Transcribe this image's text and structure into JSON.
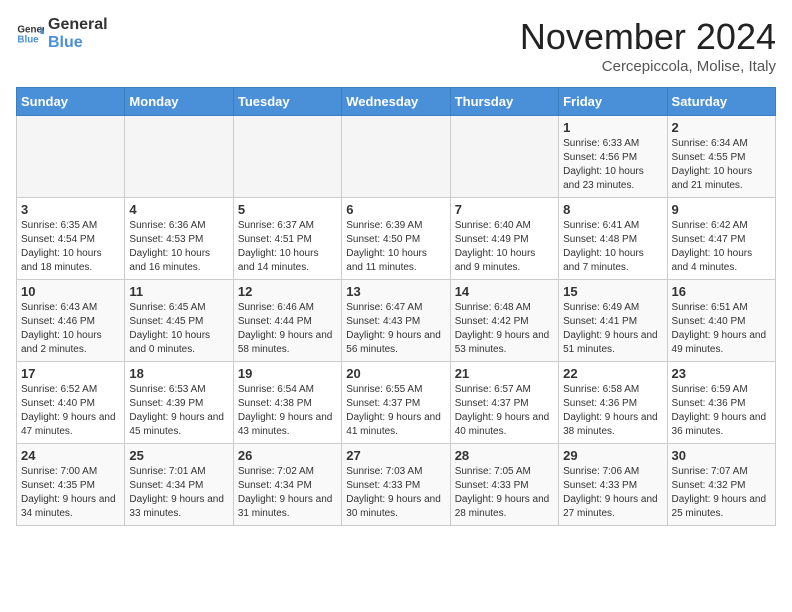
{
  "header": {
    "logo_general": "General",
    "logo_blue": "Blue",
    "title": "November 2024",
    "location": "Cercepiccola, Molise, Italy"
  },
  "weekdays": [
    "Sunday",
    "Monday",
    "Tuesday",
    "Wednesday",
    "Thursday",
    "Friday",
    "Saturday"
  ],
  "weeks": [
    [
      {
        "day": "",
        "info": ""
      },
      {
        "day": "",
        "info": ""
      },
      {
        "day": "",
        "info": ""
      },
      {
        "day": "",
        "info": ""
      },
      {
        "day": "",
        "info": ""
      },
      {
        "day": "1",
        "info": "Sunrise: 6:33 AM\nSunset: 4:56 PM\nDaylight: 10 hours\nand 23 minutes."
      },
      {
        "day": "2",
        "info": "Sunrise: 6:34 AM\nSunset: 4:55 PM\nDaylight: 10 hours\nand 21 minutes."
      }
    ],
    [
      {
        "day": "3",
        "info": "Sunrise: 6:35 AM\nSunset: 4:54 PM\nDaylight: 10 hours\nand 18 minutes."
      },
      {
        "day": "4",
        "info": "Sunrise: 6:36 AM\nSunset: 4:53 PM\nDaylight: 10 hours\nand 16 minutes."
      },
      {
        "day": "5",
        "info": "Sunrise: 6:37 AM\nSunset: 4:51 PM\nDaylight: 10 hours\nand 14 minutes."
      },
      {
        "day": "6",
        "info": "Sunrise: 6:39 AM\nSunset: 4:50 PM\nDaylight: 10 hours\nand 11 minutes."
      },
      {
        "day": "7",
        "info": "Sunrise: 6:40 AM\nSunset: 4:49 PM\nDaylight: 10 hours\nand 9 minutes."
      },
      {
        "day": "8",
        "info": "Sunrise: 6:41 AM\nSunset: 4:48 PM\nDaylight: 10 hours\nand 7 minutes."
      },
      {
        "day": "9",
        "info": "Sunrise: 6:42 AM\nSunset: 4:47 PM\nDaylight: 10 hours\nand 4 minutes."
      }
    ],
    [
      {
        "day": "10",
        "info": "Sunrise: 6:43 AM\nSunset: 4:46 PM\nDaylight: 10 hours\nand 2 minutes."
      },
      {
        "day": "11",
        "info": "Sunrise: 6:45 AM\nSunset: 4:45 PM\nDaylight: 10 hours\nand 0 minutes."
      },
      {
        "day": "12",
        "info": "Sunrise: 6:46 AM\nSunset: 4:44 PM\nDaylight: 9 hours\nand 58 minutes."
      },
      {
        "day": "13",
        "info": "Sunrise: 6:47 AM\nSunset: 4:43 PM\nDaylight: 9 hours\nand 56 minutes."
      },
      {
        "day": "14",
        "info": "Sunrise: 6:48 AM\nSunset: 4:42 PM\nDaylight: 9 hours\nand 53 minutes."
      },
      {
        "day": "15",
        "info": "Sunrise: 6:49 AM\nSunset: 4:41 PM\nDaylight: 9 hours\nand 51 minutes."
      },
      {
        "day": "16",
        "info": "Sunrise: 6:51 AM\nSunset: 4:40 PM\nDaylight: 9 hours\nand 49 minutes."
      }
    ],
    [
      {
        "day": "17",
        "info": "Sunrise: 6:52 AM\nSunset: 4:40 PM\nDaylight: 9 hours\nand 47 minutes."
      },
      {
        "day": "18",
        "info": "Sunrise: 6:53 AM\nSunset: 4:39 PM\nDaylight: 9 hours\nand 45 minutes."
      },
      {
        "day": "19",
        "info": "Sunrise: 6:54 AM\nSunset: 4:38 PM\nDaylight: 9 hours\nand 43 minutes."
      },
      {
        "day": "20",
        "info": "Sunrise: 6:55 AM\nSunset: 4:37 PM\nDaylight: 9 hours\nand 41 minutes."
      },
      {
        "day": "21",
        "info": "Sunrise: 6:57 AM\nSunset: 4:37 PM\nDaylight: 9 hours\nand 40 minutes."
      },
      {
        "day": "22",
        "info": "Sunrise: 6:58 AM\nSunset: 4:36 PM\nDaylight: 9 hours\nand 38 minutes."
      },
      {
        "day": "23",
        "info": "Sunrise: 6:59 AM\nSunset: 4:36 PM\nDaylight: 9 hours\nand 36 minutes."
      }
    ],
    [
      {
        "day": "24",
        "info": "Sunrise: 7:00 AM\nSunset: 4:35 PM\nDaylight: 9 hours\nand 34 minutes."
      },
      {
        "day": "25",
        "info": "Sunrise: 7:01 AM\nSunset: 4:34 PM\nDaylight: 9 hours\nand 33 minutes."
      },
      {
        "day": "26",
        "info": "Sunrise: 7:02 AM\nSunset: 4:34 PM\nDaylight: 9 hours\nand 31 minutes."
      },
      {
        "day": "27",
        "info": "Sunrise: 7:03 AM\nSunset: 4:33 PM\nDaylight: 9 hours\nand 30 minutes."
      },
      {
        "day": "28",
        "info": "Sunrise: 7:05 AM\nSunset: 4:33 PM\nDaylight: 9 hours\nand 28 minutes."
      },
      {
        "day": "29",
        "info": "Sunrise: 7:06 AM\nSunset: 4:33 PM\nDaylight: 9 hours\nand 27 minutes."
      },
      {
        "day": "30",
        "info": "Sunrise: 7:07 AM\nSunset: 4:32 PM\nDaylight: 9 hours\nand 25 minutes."
      }
    ]
  ]
}
